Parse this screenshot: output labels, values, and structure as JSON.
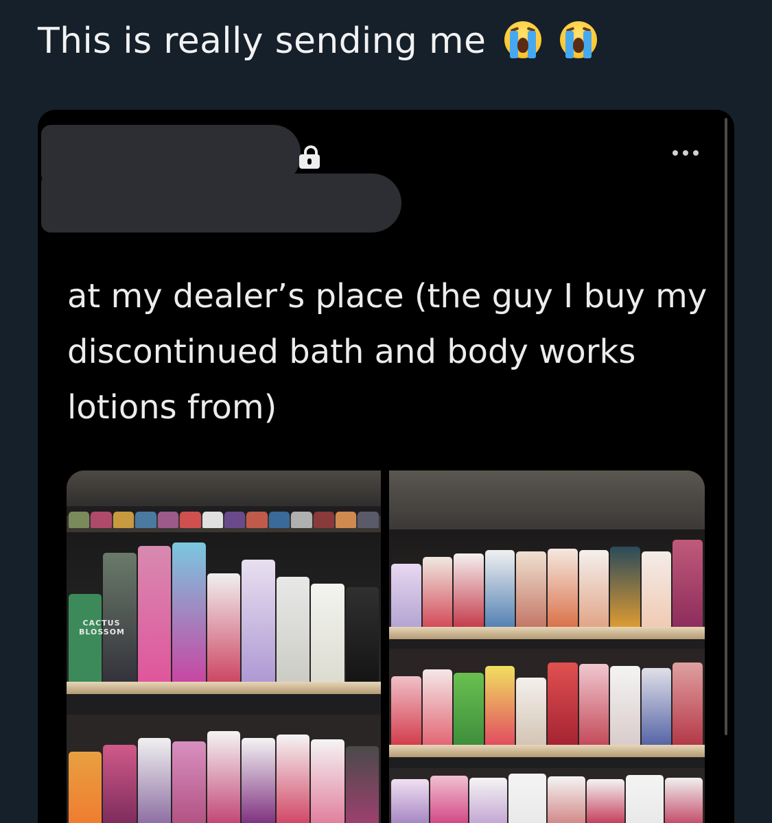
{
  "caption": "This is really sending me",
  "caption_emoji": [
    "loudly-crying-face-icon",
    "loudly-crying-face-icon"
  ],
  "embedded_post": {
    "author_redacted": true,
    "protected_account": true,
    "text": "at my dealer’s place (the guy I buy my discontinued bath and body works lotions from)",
    "photos": [
      {
        "label": "CACTUS BLOSSOM"
      },
      {
        "label": ""
      }
    ]
  },
  "colors": {
    "background": "#15202b",
    "card": "#000000",
    "text": "#ececec",
    "redaction": "#2c2e33"
  }
}
